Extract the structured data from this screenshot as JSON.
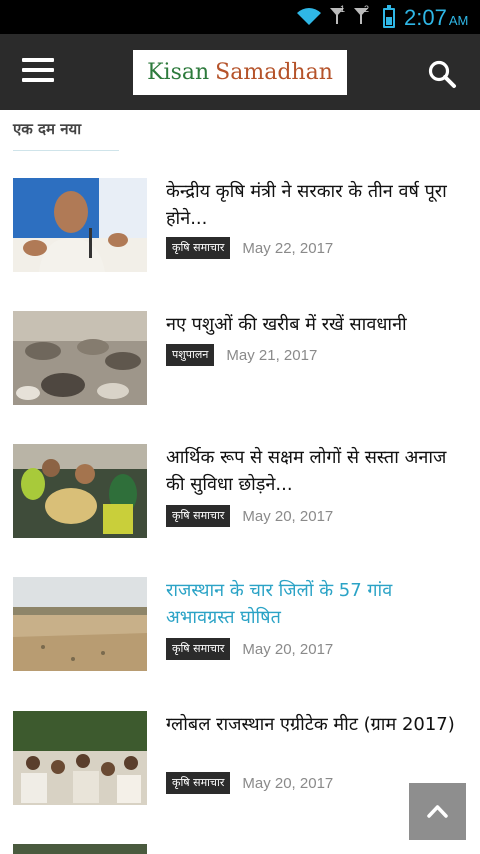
{
  "status_bar": {
    "time": "2:07",
    "ampm": "AM",
    "sim1": "1",
    "sim2": "2"
  },
  "header": {
    "logo_part1": "Kisan",
    "logo_part2": "Samadhan"
  },
  "section": {
    "title": "एक दम नया"
  },
  "articles": [
    {
      "title": "केन्द्रीय कृषि मंत्री ने सरकार के तीन वर्ष पूरा होने...",
      "category": "कृषि समाचार",
      "date": "May 22, 2017"
    },
    {
      "title": "नए पशुओं की खरीब में रखें सावधानी",
      "category": "पशुपालन",
      "date": "May 21, 2017"
    },
    {
      "title": "आर्थिक रूप से सक्षम लोगों से सस्ता अनाज की सुविधा छोड़ने...",
      "category": "कृषि समाचार",
      "date": "May 20, 2017"
    },
    {
      "title": "राजस्थान के चार जिलों के 57 गांव अभावग्रस्त घोषित",
      "category": "कृषि समाचार",
      "date": "May 20, 2017"
    },
    {
      "title": "ग्लोबल राजस्थान एग्रीटेक मीट (ग्राम 2017)",
      "category": "कृषि समाचार",
      "date": "May 20, 2017"
    }
  ],
  "colors": {
    "header_bg": "#2b2b2b",
    "status_accent": "#2fb7e6",
    "link_highlight": "#2ba3c6",
    "badge_bg": "#2b2b2b"
  }
}
